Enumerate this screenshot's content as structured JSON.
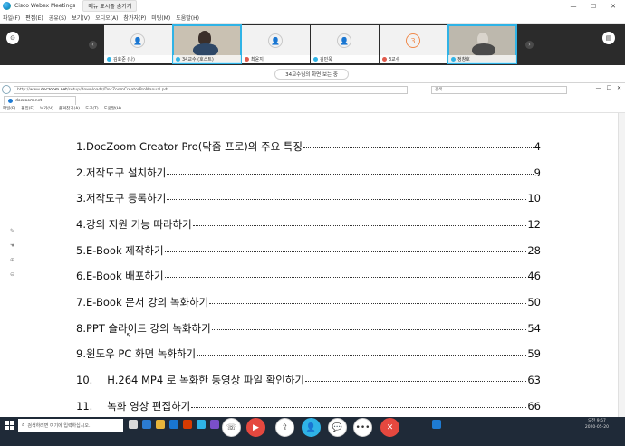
{
  "window": {
    "title": "Cisco Webex Meetings",
    "hide_menu_label": "메뉴 표시줄 숨기기",
    "minimize": "—",
    "maximize": "☐",
    "close": "✕"
  },
  "menubar": {
    "items": [
      "파일(F)",
      "편집(E)",
      "공유(S)",
      "보기(V)",
      "오디오(A)",
      "참가자(P)",
      "미팅(M)",
      "도움말(H)"
    ]
  },
  "participants": [
    {
      "name": "김효준 (나)",
      "has_video": false,
      "avatar_glyph": "👤",
      "muted": false
    },
    {
      "name": "34교수 (호스트)",
      "has_video": true,
      "avatar_glyph": "",
      "muted": false
    },
    {
      "name": "최윤지",
      "has_video": false,
      "avatar_glyph": "👤",
      "muted": true
    },
    {
      "name": "김민욱",
      "has_video": false,
      "avatar_glyph": "👤",
      "muted": false
    },
    {
      "name": "3교수",
      "has_video": false,
      "avatar_glyph": "3",
      "muted": true
    },
    {
      "name": "정창호",
      "has_video": true,
      "avatar_glyph": "",
      "muted": false
    }
  ],
  "share_banner": "34교수님의 화면 보는 중",
  "browser": {
    "url_prefix": "http://www.",
    "url_domain": "doczoom.net",
    "url_path": "/setup/downloads/DocZoomCreatorProManual.pdf",
    "search_placeholder": "검색...",
    "tab_label": "doczoom.net",
    "menu": [
      "파일(F)",
      "편집(E)",
      "보기(V)",
      "즐겨찾기(A)",
      "도구(T)",
      "도움말(H)"
    ]
  },
  "toc": [
    {
      "num": "1.",
      "title": "DocZoom Creator Pro(닥줌 프로)의 주요 특징",
      "page": "4"
    },
    {
      "num": "2.",
      "title": "저작도구 설치하기",
      "page": "9"
    },
    {
      "num": "3.",
      "title": "저작도구 등록하기",
      "page": "10"
    },
    {
      "num": "4.",
      "title": "강의 지원 기능 따라하기",
      "page": "12"
    },
    {
      "num": "5.",
      "title": "E-Book 제작하기",
      "page": "28"
    },
    {
      "num": "6.",
      "title": "E-Book 배포하기",
      "page": "46"
    },
    {
      "num": "7.",
      "title": "E-Book 문서 강의 녹화하기",
      "page": "50"
    },
    {
      "num": "8.",
      "title": "PPT 슬라이드 강의 녹화하기",
      "page": "54"
    },
    {
      "num": "9.",
      "title": "윈도우 PC 화면 녹화하기",
      "page": "59"
    },
    {
      "num": "10.",
      "title": "H.264 MP4 로 녹화한 동영상 파일 확인하기",
      "page": "63"
    },
    {
      "num": "11.",
      "title": "녹화 영상 편집하기",
      "page": "66"
    }
  ],
  "taskbar": {
    "search_placeholder": "검색하려면 여기에 입력하십시오.",
    "time": "오전 9:57",
    "date": "2020-05-20"
  },
  "colors": {
    "strip_bg": "#2b2b2b",
    "accent": "#2fb3e6",
    "end_red": "#e5483f",
    "taskbar_bg": "#1f2a38"
  }
}
